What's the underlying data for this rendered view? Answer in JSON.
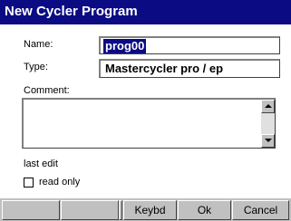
{
  "window": {
    "title": "New Cycler Program"
  },
  "form": {
    "name_label": "Name:",
    "name_value": "prog00",
    "type_label": "Type:",
    "type_value": "Mastercycler pro / ep",
    "comment_label": "Comment:",
    "comment_value": "",
    "last_edit_label": "last edit",
    "read_only_label": "read only",
    "read_only_checked": false
  },
  "buttons": {
    "blank1": "",
    "blank2": "",
    "blank3": "",
    "keybd": "Keybd",
    "ok": "Ok",
    "cancel": "Cancel"
  },
  "colors": {
    "titlebar": "#0b0b84",
    "selection": "#0b0b84",
    "button_face": "#c0c0c0"
  }
}
